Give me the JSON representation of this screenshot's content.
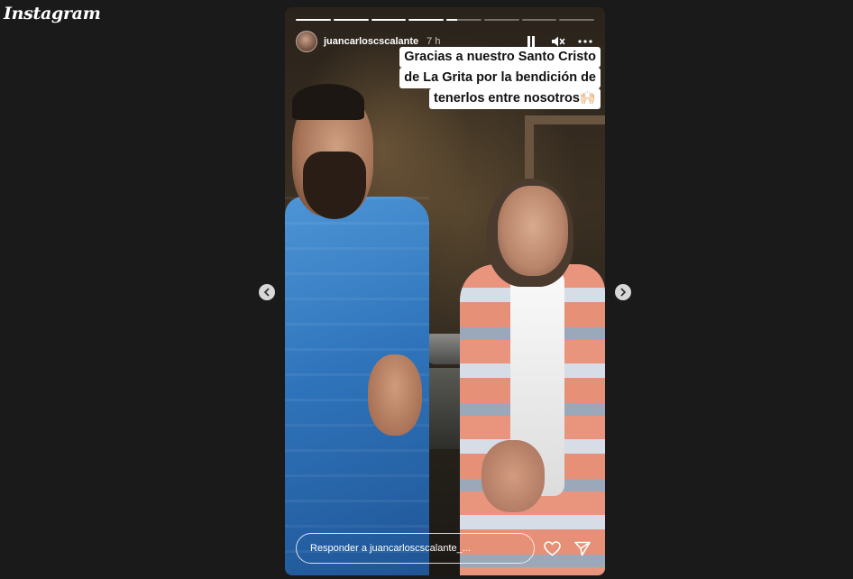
{
  "app": {
    "logo_text": "Instagram"
  },
  "story": {
    "progress": [
      1,
      1,
      1,
      1,
      0.3,
      0,
      0,
      0
    ],
    "username": "juancarloscscalante",
    "time_ago": "7 h",
    "caption_lines": [
      "Gracias a nuestro Santo Cristo",
      "de La Grita por la bendición de",
      "tenerlos entre nosotros🙌🏻"
    ],
    "reply_placeholder": "Responder a juancarloscscalante_...",
    "icons": {
      "pause": "pause-icon",
      "mute": "mute-icon",
      "more": "more-options-icon",
      "like": "heart-icon",
      "share": "send-icon",
      "prev": "chevron-left-icon",
      "next": "chevron-right-icon"
    }
  }
}
